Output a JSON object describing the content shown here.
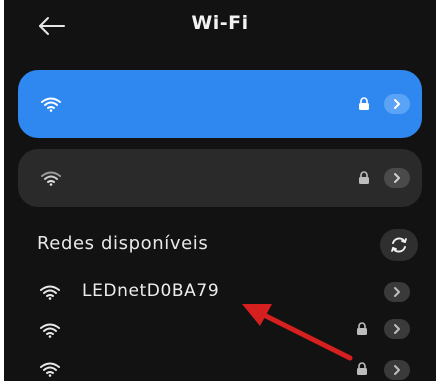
{
  "header": {
    "title": "Wi-Fi",
    "back_icon": "arrow-left-icon"
  },
  "connected_network": {
    "ssid": "",
    "secured": true,
    "icons": [
      "wifi-icon",
      "lock-icon",
      "chevron-right-icon"
    ]
  },
  "saved_network": {
    "ssid": "",
    "secured": true,
    "icons": [
      "wifi-icon",
      "lock-icon",
      "chevron-right-icon"
    ]
  },
  "available": {
    "section_title": "Redes disponíveis",
    "refresh_icon": "refresh-icon",
    "networks": [
      {
        "ssid": "LEDnetD0BA79",
        "secured": false
      },
      {
        "ssid": "",
        "secured": true
      },
      {
        "ssid": "",
        "secured": true
      }
    ]
  },
  "annotation": {
    "icon": "red-arrow-icon",
    "color": "#d61f1f"
  },
  "colors": {
    "background": "#121212",
    "accent": "#2f87f0",
    "card_dark": "#2a2a2a",
    "text": "#f2f2f2"
  }
}
